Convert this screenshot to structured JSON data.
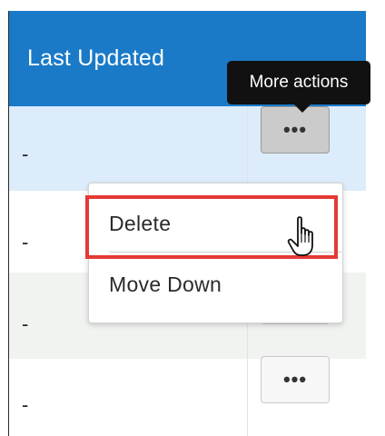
{
  "table": {
    "header": {
      "last_updated_label": "Last Updated"
    },
    "rows": [
      {
        "last_updated": "-",
        "action_label": "•••"
      },
      {
        "last_updated": "-",
        "action_label": ""
      },
      {
        "last_updated": "-",
        "action_label": ""
      },
      {
        "last_updated": "-",
        "action_label": "•••"
      }
    ]
  },
  "tooltip": {
    "text": "More actions"
  },
  "menu": {
    "items": [
      {
        "label": "Delete"
      },
      {
        "label": "Move Down"
      }
    ]
  },
  "colors": {
    "header_bg": "#1a7ac8",
    "selected_row_bg": "#dcecfb",
    "highlight_border": "#e53935",
    "tooltip_bg": "#111111"
  },
  "icons": {
    "more_actions": "ellipsis-icon",
    "cursor": "hand-pointer-cursor-icon"
  }
}
